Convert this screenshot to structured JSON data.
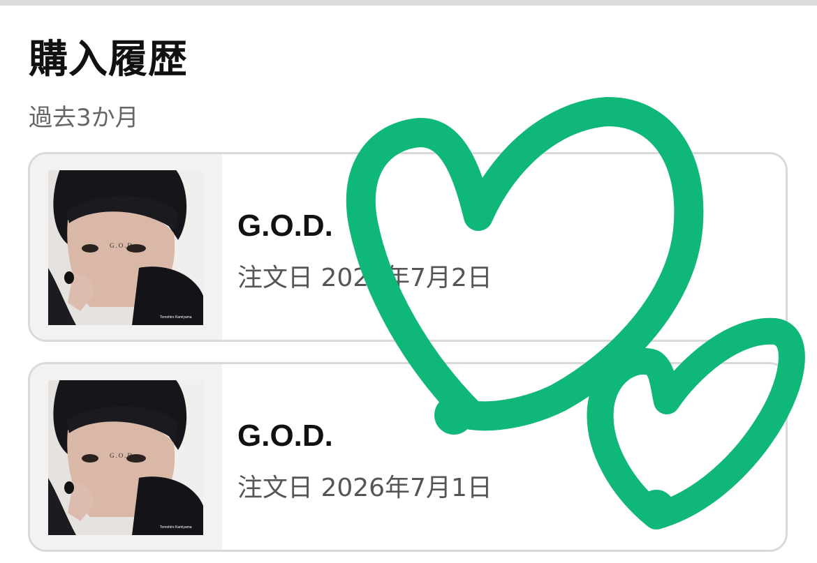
{
  "page": {
    "title": "購入履歴",
    "period": "過去3か月"
  },
  "orders": [
    {
      "title": "G.O.D.",
      "date": "注文日 2026年7月2日",
      "cover": {
        "title": "G.O.D.",
        "artist": "Tomohiro Kamiyama"
      }
    },
    {
      "title": "G.O.D.",
      "date": "注文日 2026年7月1日",
      "cover": {
        "title": "G.O.D.",
        "artist": "Tomohiro Kamiyama"
      }
    }
  ],
  "colors": {
    "heart_stroke": "#0fb878",
    "card_border": "#d9d9d9",
    "thumb_bg": "#f2f2f2"
  }
}
